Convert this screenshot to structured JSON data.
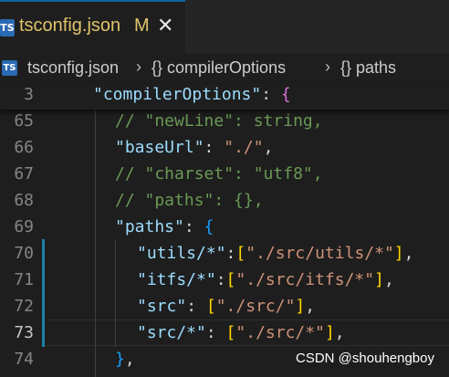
{
  "tab": {
    "icon_label": "TS",
    "file_name": "tsconfig.json",
    "modified_marker": "M",
    "close_glyph": "✕"
  },
  "breadcrumb": {
    "file": "tsconfig.json",
    "separator": "›",
    "items": [
      "{} compilerOptions",
      "{} paths"
    ]
  },
  "sticky": {
    "line_number": "3",
    "key": "\"compilerOptions\"",
    "colon": ": ",
    "brace": "{"
  },
  "lines": [
    {
      "num": "65",
      "parts": [
        [
          "c",
          "// \"newLine\": string,"
        ]
      ]
    },
    {
      "num": "66",
      "parts": [
        [
          "k",
          "\"baseUrl\""
        ],
        [
          "p",
          ": "
        ],
        [
          "s",
          "\"./\""
        ],
        [
          "p",
          ","
        ]
      ]
    },
    {
      "num": "67",
      "parts": [
        [
          "c",
          "// \"charset\": \"utf8\","
        ]
      ]
    },
    {
      "num": "68",
      "parts": [
        [
          "c",
          "// \"paths\": {},"
        ]
      ]
    },
    {
      "num": "69",
      "parts": [
        [
          "k",
          "\"paths\""
        ],
        [
          "p",
          ": "
        ],
        [
          "b3",
          "{"
        ]
      ]
    },
    {
      "num": "70",
      "parts": [
        [
          "k",
          "\"utils/*\""
        ],
        [
          "p",
          ":"
        ],
        [
          "b1",
          "["
        ],
        [
          "s",
          "\"./src/utils/*\""
        ],
        [
          "b1",
          "]"
        ],
        [
          "p",
          ","
        ]
      ]
    },
    {
      "num": "71",
      "parts": [
        [
          "k",
          "\"itfs/*\""
        ],
        [
          "p",
          ":"
        ],
        [
          "b1",
          "["
        ],
        [
          "s",
          "\"./src/itfs/*\""
        ],
        [
          "b1",
          "]"
        ],
        [
          "p",
          ","
        ]
      ]
    },
    {
      "num": "72",
      "parts": [
        [
          "k",
          "\"src\""
        ],
        [
          "p",
          ": "
        ],
        [
          "b1",
          "["
        ],
        [
          "s",
          "\"./src/\""
        ],
        [
          "b1",
          "]"
        ],
        [
          "p",
          ","
        ]
      ]
    },
    {
      "num": "73",
      "parts": [
        [
          "k",
          "\"src/*\""
        ],
        [
          "p",
          ": "
        ],
        [
          "b1",
          "["
        ],
        [
          "s",
          "\"./src/*\""
        ],
        [
          "b1",
          "]"
        ],
        [
          "p",
          ","
        ]
      ]
    },
    {
      "num": "74",
      "parts": [
        [
          "b3",
          "}"
        ],
        [
          "p",
          ","
        ]
      ]
    }
  ],
  "active_line": "73",
  "watermark": "CSDN @shouhengboy"
}
